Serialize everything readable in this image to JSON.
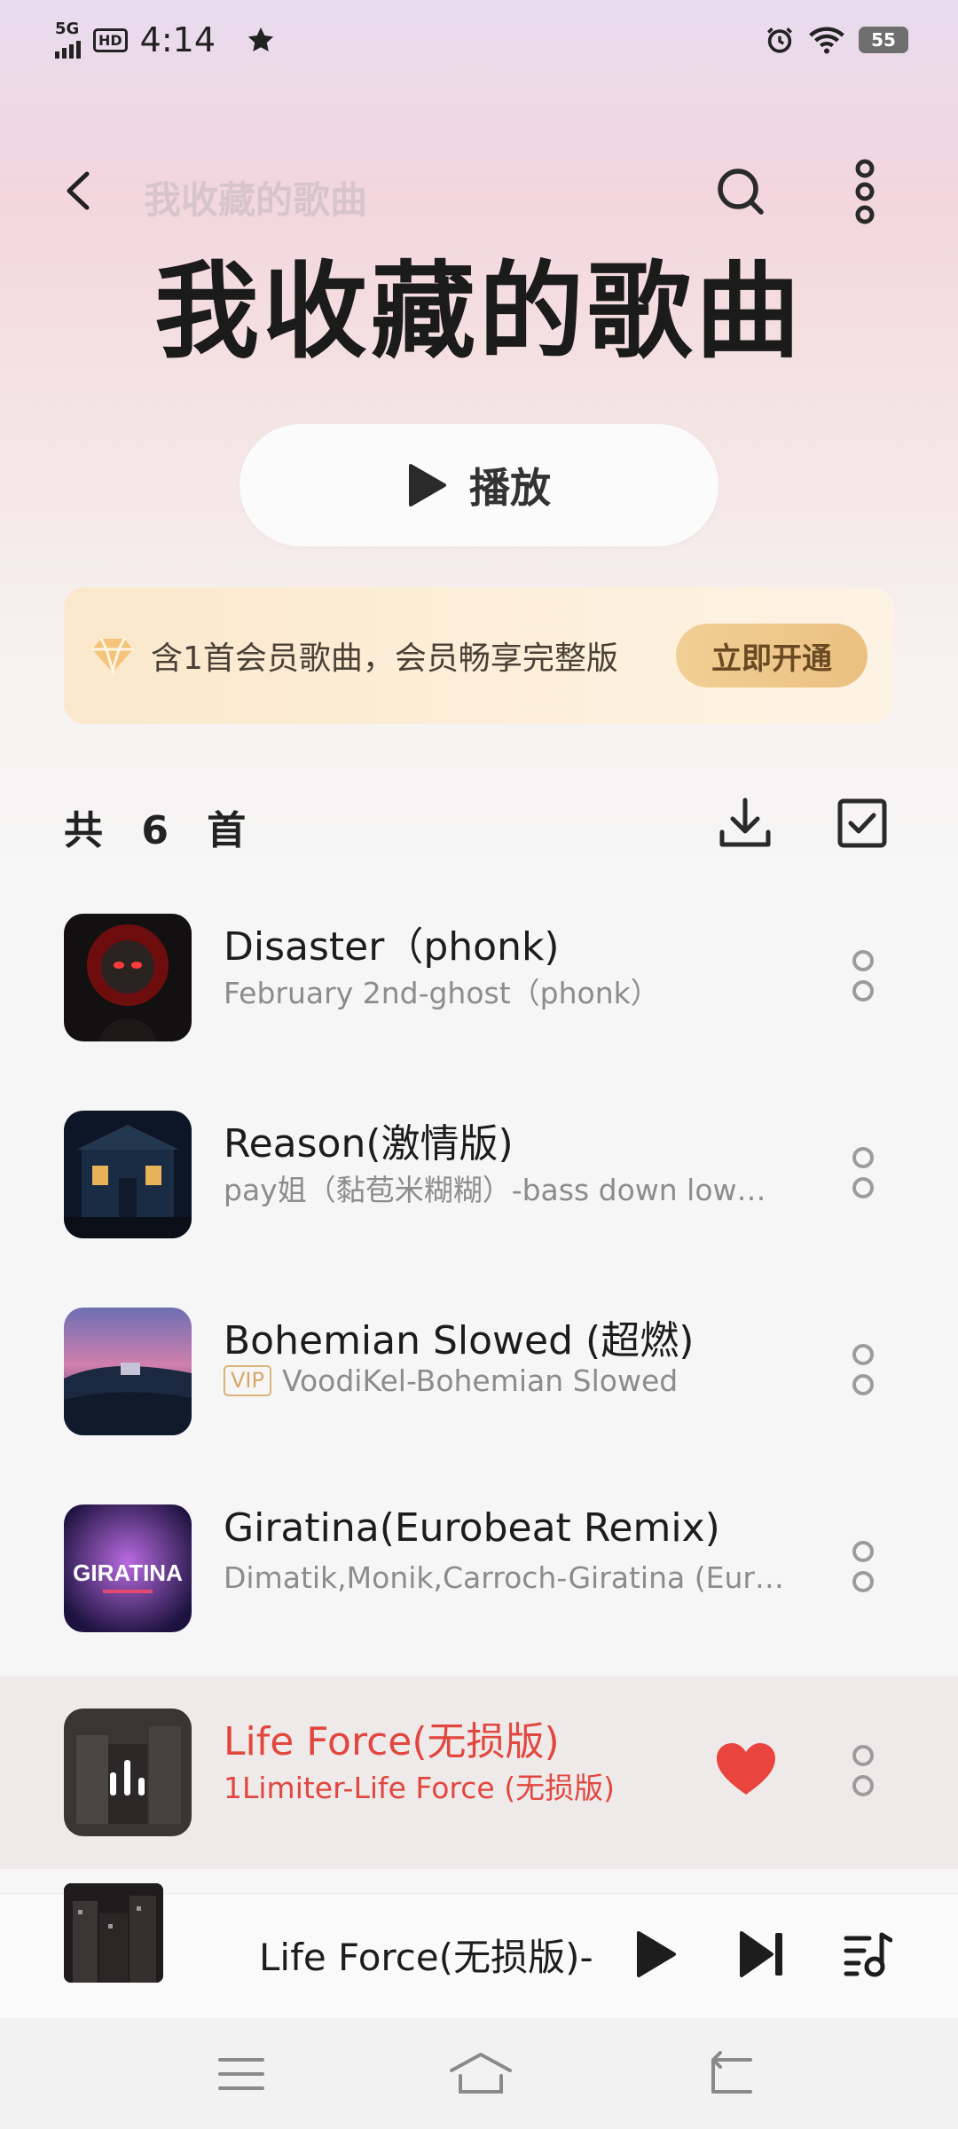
{
  "status_bar": {
    "network": "5G",
    "hd": "HD",
    "time": "4:14",
    "battery": "55"
  },
  "header": {
    "small_title": "我收藏的歌曲",
    "title": "我收藏的歌曲",
    "play_label": "播放"
  },
  "vip_banner": {
    "text": "含1首会员歌曲，会员畅享完整版",
    "button": "立即开通"
  },
  "list": {
    "count_text": "共 6 首"
  },
  "songs": [
    {
      "title": "Disaster（phonk)",
      "subtitle": "February  2nd-ghost（phonk）",
      "vip": false,
      "playing": false
    },
    {
      "title": "Reason(激情版)",
      "subtitle": "pay姐（黏苞米糊糊）-bass  down  low…",
      "vip": false,
      "playing": false
    },
    {
      "title": "Bohemian  Slowed  (超燃)",
      "subtitle": "VoodiKel-Bohemian  Slowed",
      "vip": true,
      "vip_label": "VIP",
      "playing": false
    },
    {
      "title": "Giratina(Eurobeat  Remix)",
      "subtitle": "Dimatik,Monik,Carroch-Giratina  (Eur…",
      "vip": false,
      "playing": false
    },
    {
      "title": "Life  Force(无损版)",
      "subtitle": "1Limiter-Life  Force  (无损版)",
      "vip": false,
      "playing": true,
      "liked": true
    }
  ],
  "cover_art": {
    "giratina_text": "GIRATINA"
  },
  "mini_player": {
    "title": "Life  Force(无损版)-"
  },
  "colors": {
    "accent_red": "#e2473f",
    "vip_gold": "#ebc081"
  }
}
